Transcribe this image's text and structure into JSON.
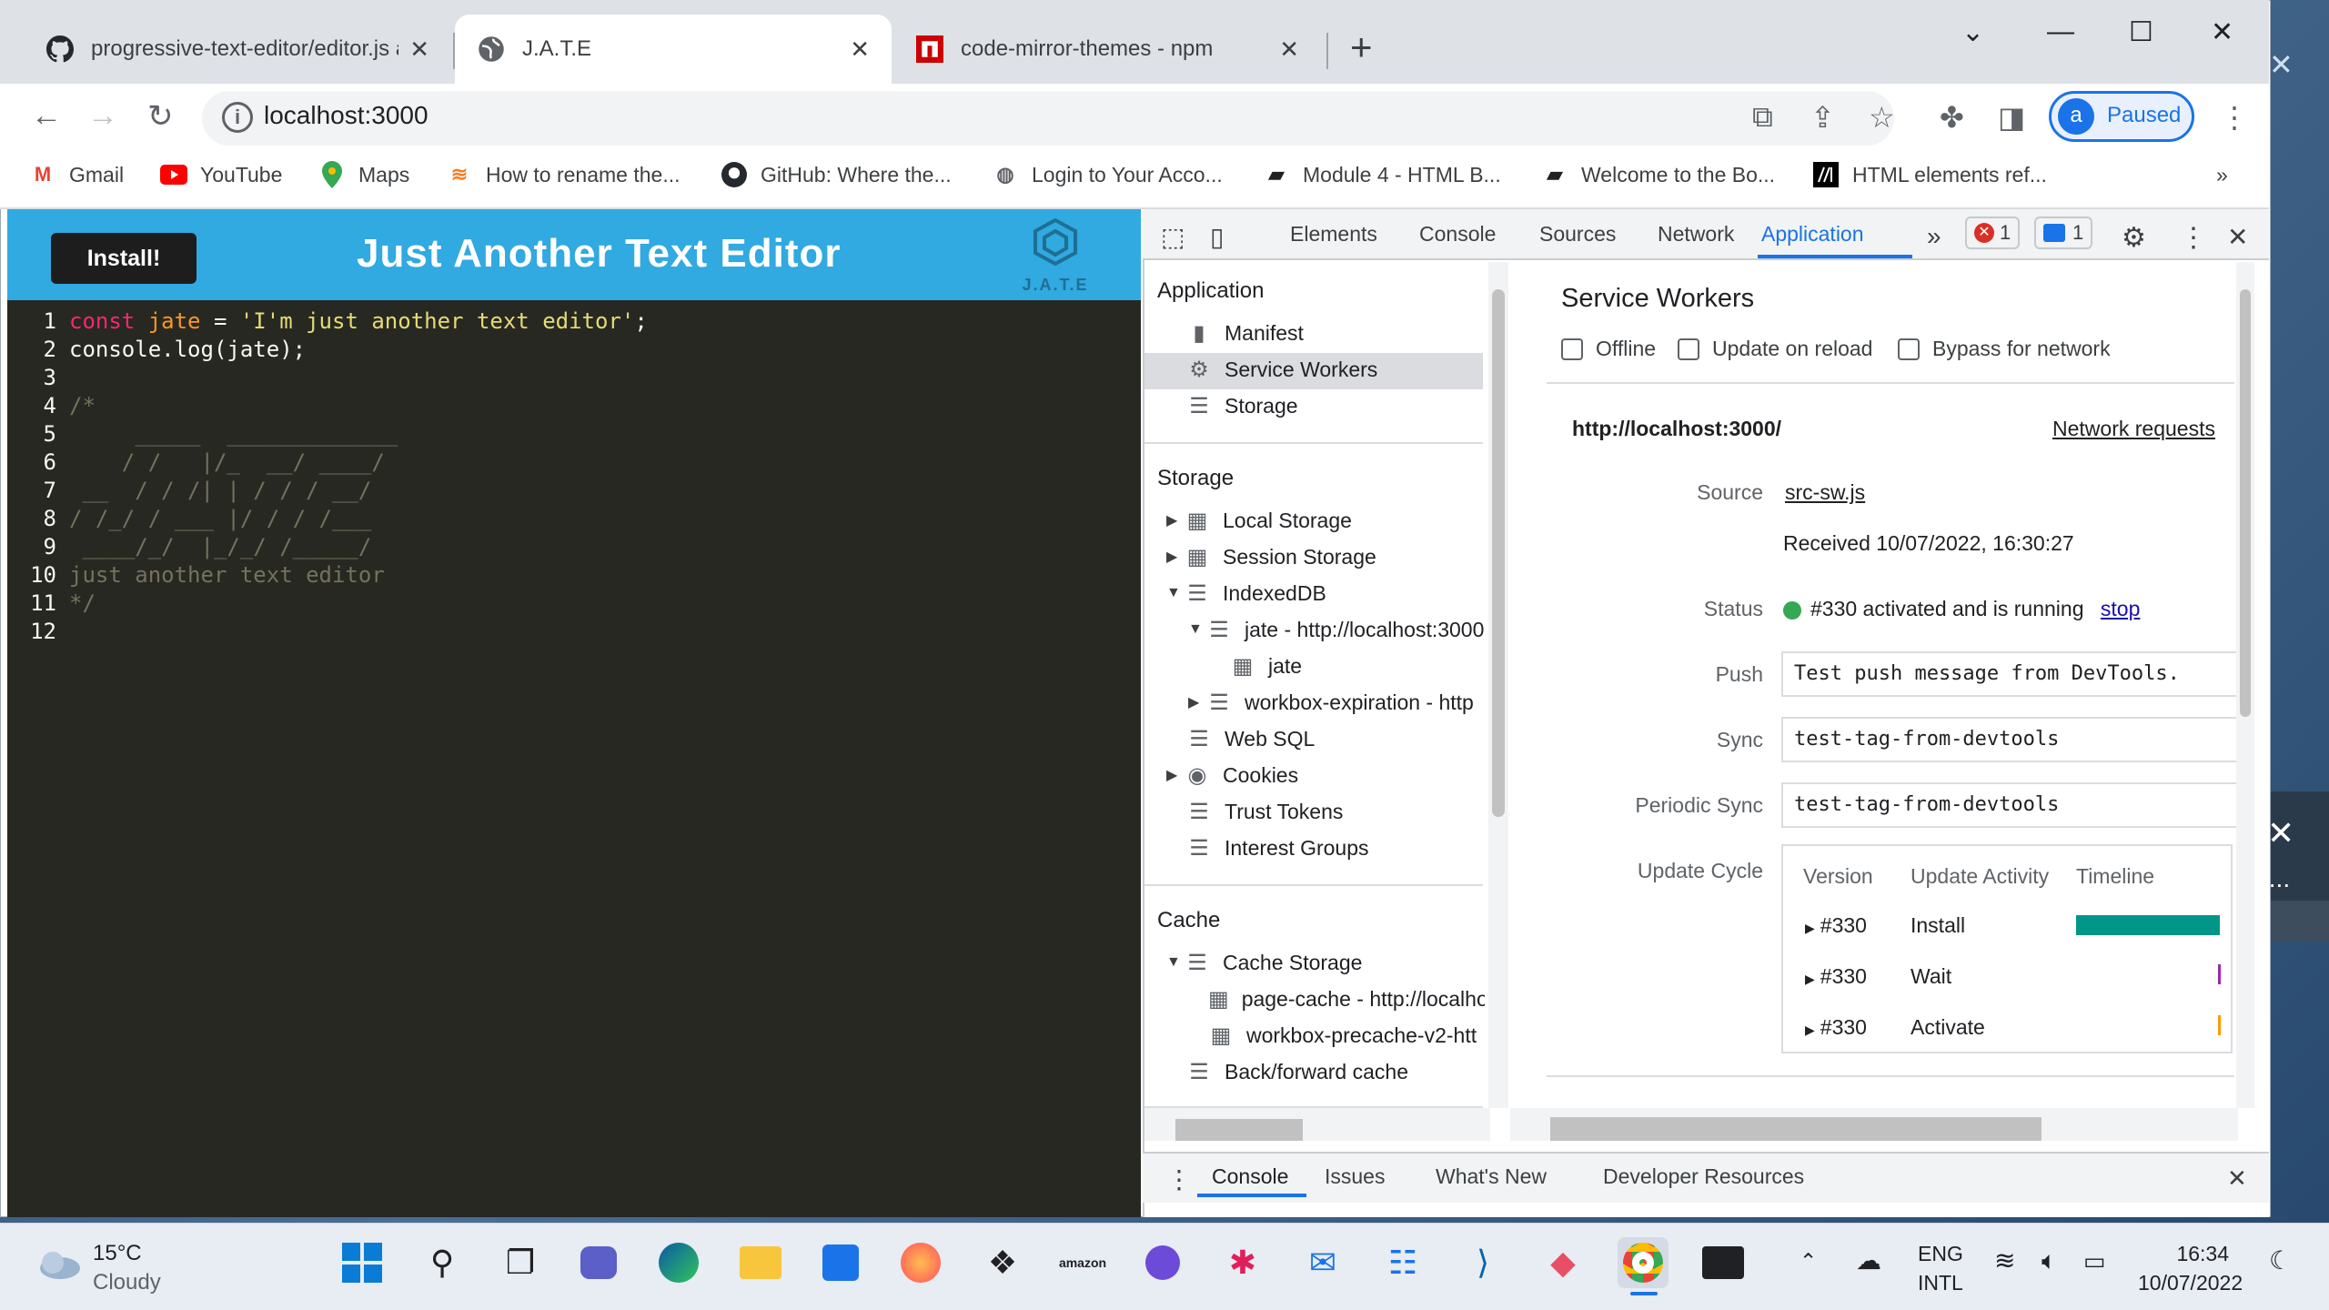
{
  "browser": {
    "tabs": [
      {
        "title": "progressive-text-editor/editor.js at main",
        "icon": "github-icon"
      },
      {
        "title": "J.A.T.E",
        "icon": "globe-icon"
      },
      {
        "title": "code-mirror-themes - npm",
        "icon": "npm-icon"
      }
    ],
    "url": "localhost:3000",
    "profile": {
      "initial": "a",
      "status": "Paused"
    },
    "bookmarks": [
      {
        "label": "Gmail",
        "icon": "gmail-icon"
      },
      {
        "label": "YouTube",
        "icon": "youtube-icon"
      },
      {
        "label": "Maps",
        "icon": "maps-icon"
      },
      {
        "label": "How to rename the...",
        "icon": "bookmark-stack-icon"
      },
      {
        "label": "GitHub: Where the...",
        "icon": "github-icon"
      },
      {
        "label": "Login to Your Acco...",
        "icon": "globe-icon"
      },
      {
        "label": "Module 4 - HTML B...",
        "icon": "book-icon"
      },
      {
        "label": "Welcome to the Bo...",
        "icon": "book-icon"
      },
      {
        "label": "HTML elements ref...",
        "icon": "mdn-icon"
      }
    ],
    "more_bookmarks": "»"
  },
  "app": {
    "install_label": "Install!",
    "title": "Just Another Text Editor",
    "logo_text": "J.A.T.E",
    "code_lines": [
      "const jate = 'I'm just another text editor';",
      "console.log(jate);",
      "",
      "/*",
      "     _____  _____________",
      "    / /   |/_  __/ ____/",
      " __  / / /| | / / / __/",
      "/ /_/ / ___ |/ / / /___",
      " ____/_/  |_/_/ /_____/",
      "just another text editor",
      "*/",
      ""
    ],
    "code_keyword": "const",
    "code_var": "jate",
    "code_string": "'I'm just another text editor'"
  },
  "devtools": {
    "tabs": [
      "Elements",
      "Console",
      "Sources",
      "Network",
      "Application"
    ],
    "active_tab": "Application",
    "more": "»",
    "error_count": "1",
    "message_count": "1",
    "sidebar": {
      "application_heading": "Application",
      "application_items": [
        "Manifest",
        "Service Workers",
        "Storage"
      ],
      "storage_heading": "Storage",
      "storage_items": [
        "Local Storage",
        "Session Storage",
        "IndexedDB",
        "jate - http://localhost:3000",
        "jate",
        "workbox-expiration - http",
        "Web SQL",
        "Cookies",
        "Trust Tokens",
        "Interest Groups"
      ],
      "cache_heading": "Cache",
      "cache_items": [
        "Cache Storage",
        "page-cache - http://localhost",
        "workbox-precache-v2-htt",
        "Back/forward cache"
      ]
    },
    "service_workers": {
      "title": "Service Workers",
      "checkboxes": [
        "Offline",
        "Update on reload",
        "Bypass for network"
      ],
      "origin": "http://localhost:3000/",
      "network_requests_link": "Network requests",
      "source_label": "Source",
      "source_link": "src-sw.js",
      "received": "Received 10/07/2022, 16:30:27",
      "status_label": "Status",
      "status_text": "#330 activated and is running",
      "stop_link": "stop",
      "push_label": "Push",
      "push_value": "Test push message from DevTools.",
      "sync_label": "Sync",
      "sync_value": "test-tag-from-devtools",
      "periodic_label": "Periodic Sync",
      "periodic_value": "test-tag-from-devtools",
      "update_cycle_label": "Update Cycle",
      "update_headers": [
        "Version",
        "Update Activity",
        "Timeline"
      ],
      "update_rows": [
        {
          "version": "#330",
          "activity": "Install",
          "color": "#009688"
        },
        {
          "version": "#330",
          "activity": "Wait",
          "color": "#9c27b0"
        },
        {
          "version": "#330",
          "activity": "Activate",
          "color": "#ff9800"
        }
      ]
    },
    "drawer_tabs": [
      "Console",
      "Issues",
      "What's New",
      "Developer Resources"
    ]
  },
  "taskbar": {
    "temperature": "15°C",
    "condition": "Cloudy",
    "language": "ENG",
    "layout": "INTL",
    "time": "16:34",
    "date": "10/07/2022"
  },
  "colors": {
    "accent": "#31a9e1",
    "editor_bg": "#272822",
    "link": "#1a0dab",
    "devtools_active": "#1a73e8"
  }
}
